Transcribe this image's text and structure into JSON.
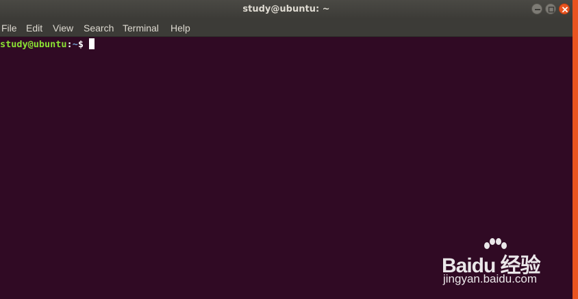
{
  "window": {
    "title": "study@ubuntu: ~",
    "controls": {
      "minimize_icon": "minimize-icon",
      "maximize_icon": "maximize-icon",
      "close_icon": "close-icon"
    }
  },
  "menu": {
    "items": [
      "File",
      "Edit",
      "View",
      "Search",
      "Terminal",
      "Help"
    ]
  },
  "terminal": {
    "prompt": {
      "user_host": "study@ubuntu",
      "separator": ":",
      "path": "~",
      "symbol": "$"
    }
  },
  "watermark": {
    "brand": "Baidu 经验",
    "url": "jingyan.baidu.com"
  },
  "colors": {
    "terminal_bg": "#300a24",
    "titlebar_bg": "#3c3b37",
    "prompt_user": "#8ae234",
    "prompt_path": "#729fcf",
    "accent": "#e95420"
  }
}
